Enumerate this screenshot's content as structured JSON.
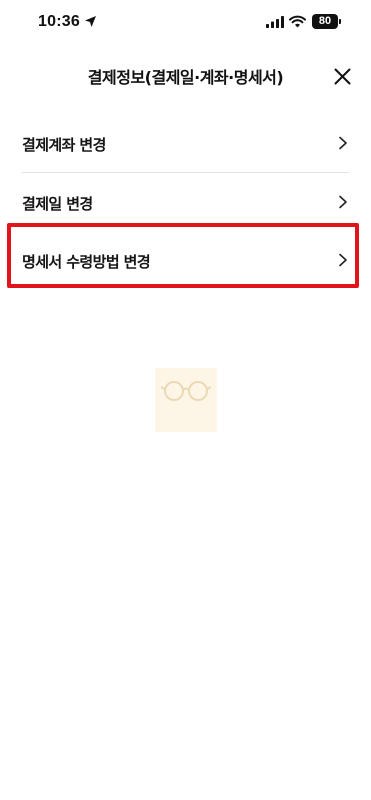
{
  "status_bar": {
    "time": "10:36",
    "battery_level": "80",
    "icons": [
      "location-arrow-icon",
      "cellular-signal-icon",
      "wifi-icon",
      "battery-icon"
    ]
  },
  "header": {
    "title": "결제정보(결제일·계좌·명세서)",
    "close_icon": "close-icon"
  },
  "menu": {
    "items": [
      {
        "label": "결제계좌 변경",
        "icon": "chevron-right-icon"
      },
      {
        "label": "결제일 변경",
        "icon": "chevron-right-icon"
      },
      {
        "label": "명세서 수령방법 변경",
        "icon": "chevron-right-icon",
        "highlighted": true
      }
    ]
  },
  "annotation": {
    "highlight_color": "#e0141a"
  },
  "watermark": {
    "icon": "glasses-logo-icon"
  },
  "colors": {
    "background": "#ffffff",
    "text": "#151515",
    "divider": "#e2e2e2"
  }
}
